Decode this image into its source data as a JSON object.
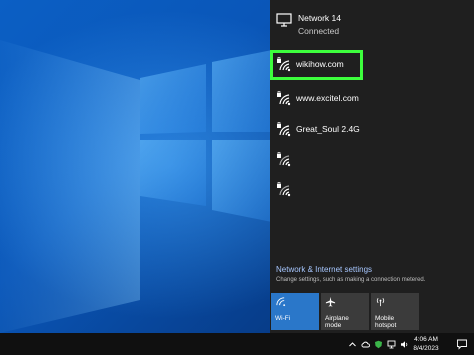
{
  "flyout": {
    "connected_network": {
      "name": "Network 14",
      "status": "Connected"
    },
    "networks": [
      {
        "name": "wikihow.com",
        "secured": true,
        "highlighted": true
      },
      {
        "name": "www.excitel.com",
        "secured": true
      },
      {
        "name": "Great_Soul 2.4G",
        "secured": true
      },
      {
        "name": "",
        "secured": true
      },
      {
        "name": "",
        "secured": true
      }
    ],
    "settings": {
      "title": "Network & Internet settings",
      "description": "Change settings, such as making a connection metered."
    },
    "quick_actions": [
      {
        "label": "Wi-Fi",
        "icon": "wifi-icon",
        "active": true
      },
      {
        "label": "Airplane mode",
        "icon": "airplane-icon",
        "active": false
      },
      {
        "label": "Mobile hotspot",
        "icon": "hotspot-icon",
        "active": false
      }
    ]
  },
  "taskbar": {
    "time": "4:06 AM",
    "date": "8/4/2023",
    "tray_icons": [
      "chevron-up-icon",
      "cloud-icon",
      "security-shield-icon",
      "network-icon",
      "volume-icon"
    ]
  },
  "colors": {
    "highlight": "#3dfe3d",
    "flyout_bg": "#1f1f1f",
    "wifi_tile_active": "#2a77c9",
    "tile_inactive": "#3b3b3b",
    "settings_link": "#a7c7ff"
  }
}
